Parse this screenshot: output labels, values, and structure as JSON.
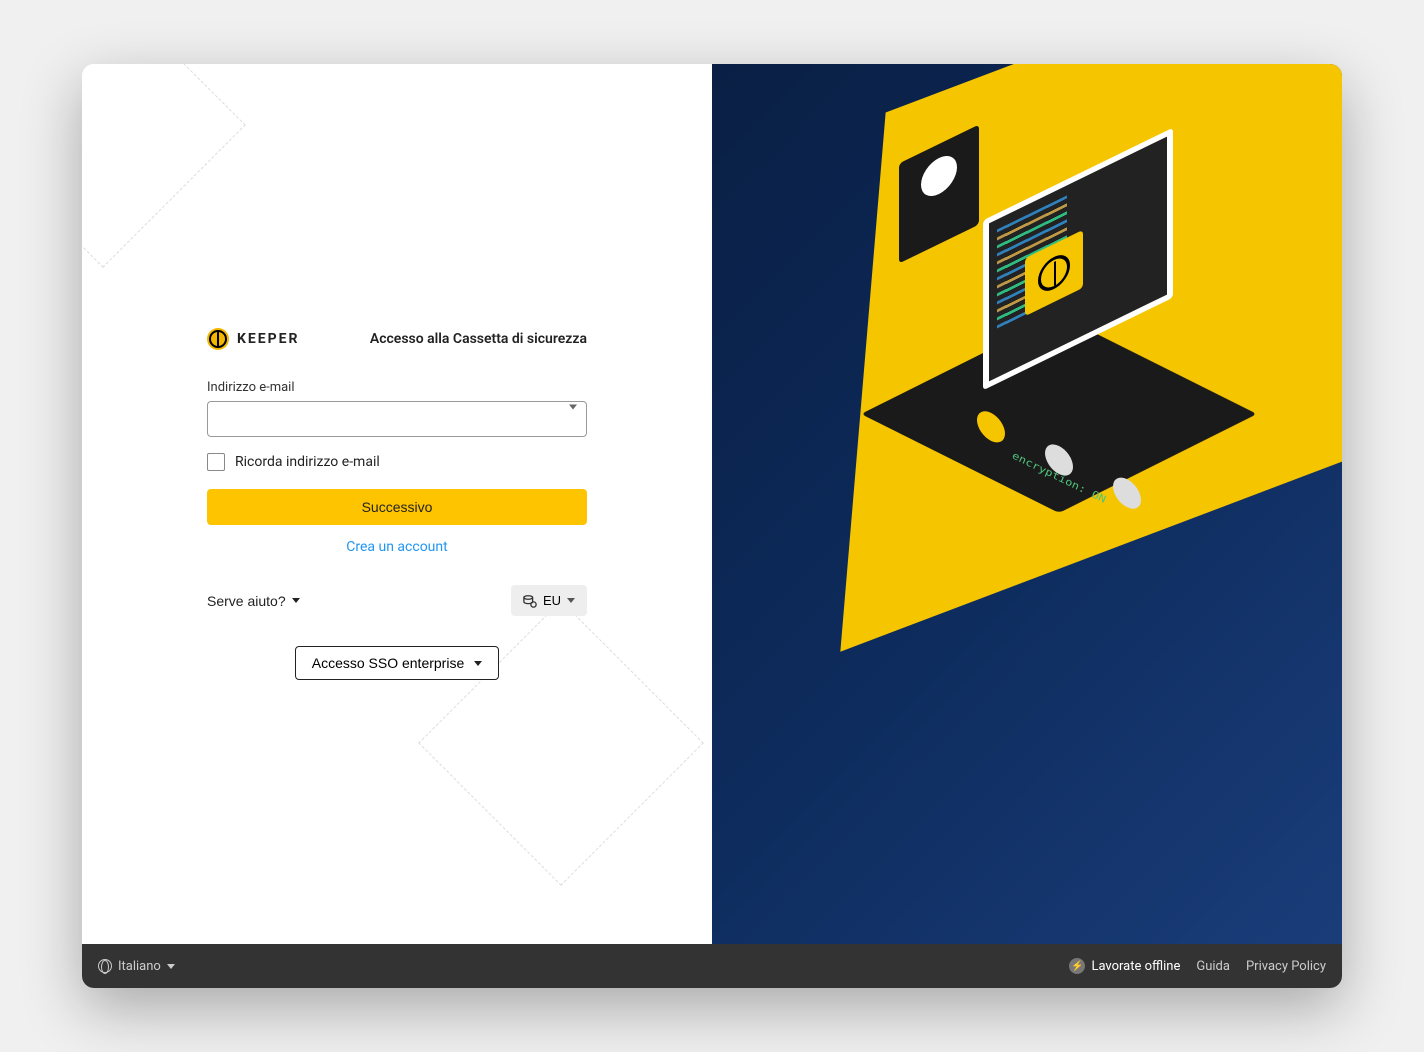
{
  "brand": {
    "name": "KEEPER"
  },
  "login": {
    "title": "Accesso alla Cassetta di sicurezza",
    "email_label": "Indirizzo e-mail",
    "email_value": "",
    "remember_label": "Ricorda indirizzo e-mail",
    "next_button": "Successivo",
    "create_account": "Crea un account",
    "help_label": "Serve aiuto?",
    "region_label": "EU",
    "sso_button": "Accesso SSO enterprise"
  },
  "illustration": {
    "encryption_text": "encryption: ON"
  },
  "footer": {
    "language": "Italiano",
    "offline": "Lavorate offline",
    "help": "Guida",
    "privacy": "Privacy Policy"
  }
}
